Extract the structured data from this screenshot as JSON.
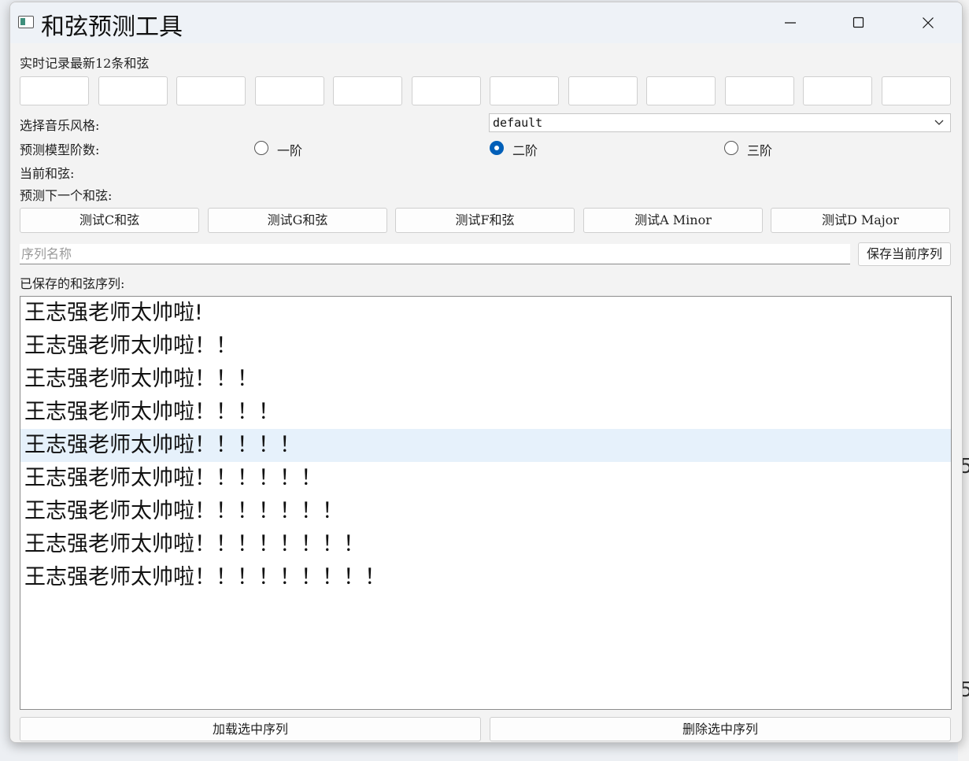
{
  "window": {
    "title": "和弦预测工具"
  },
  "history": {
    "label": "实时记录最新12条和弦",
    "chords": [
      "",
      "",
      "",
      "",
      "",
      "",
      "",
      "",
      "",
      "",
      "",
      ""
    ]
  },
  "style": {
    "label": "选择音乐风格:",
    "value": "default"
  },
  "order": {
    "label": "预测模型阶数:",
    "options": [
      {
        "label": "一阶",
        "checked": false
      },
      {
        "label": "二阶",
        "checked": true
      },
      {
        "label": "三阶",
        "checked": false
      }
    ]
  },
  "current_chord_label": "当前和弦:",
  "next_chord_label": "预测下一个和弦:",
  "test_buttons": [
    "测试C和弦",
    "测试G和弦",
    "测试F和弦",
    "测试A Minor",
    "测试D Major"
  ],
  "sequence": {
    "placeholder": "序列名称",
    "save_label": "保存当前序列"
  },
  "saved": {
    "label": "已保存的和弦序列:",
    "items": [
      "王志强老师太帅啦!",
      "王志强老师太帅啦！！",
      "王志强老师太帅啦！！！",
      "王志强老师太帅啦！！！！",
      "王志强老师太帅啦！！！！！",
      "王志强老师太帅啦！！！！！！",
      "王志强老师太帅啦！！！！！！！",
      "王志强老师太帅啦！！！！！！！！",
      "王志强老师太帅啦！！！！！！！！！"
    ],
    "selected_index": 4
  },
  "bottom": {
    "load_label": "加载选中序列",
    "delete_label": "删除选中序列"
  },
  "background_peek": [
    "5",
    "5"
  ],
  "colors": {
    "accent": "#005fb8",
    "selection": "#e6f1fb"
  }
}
